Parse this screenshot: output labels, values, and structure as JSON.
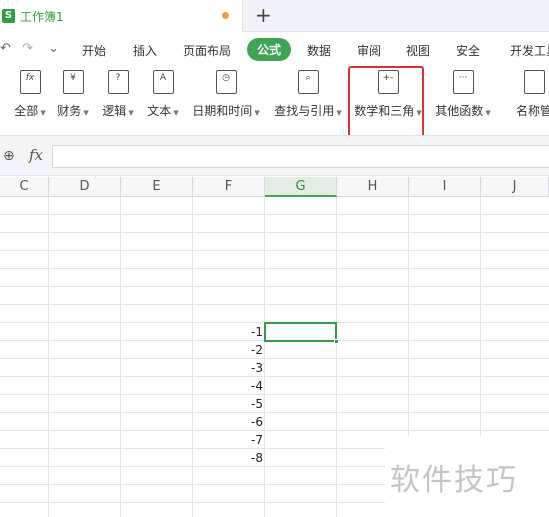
{
  "window": {
    "doc_tab_title": "工作簿1",
    "doc_icon_letter": "S",
    "new_tab_glyph": "+"
  },
  "quick_access": {
    "undo": "↶",
    "redo": "↷",
    "more": "⌄"
  },
  "menu": {
    "items": [
      "开始",
      "插入",
      "页面布局",
      "公式",
      "数据",
      "审阅",
      "视图",
      "安全",
      "开发工具"
    ],
    "active": "公式"
  },
  "ribbon": {
    "buttons": [
      {
        "label": "全部",
        "glyph": "fx"
      },
      {
        "label": "财务",
        "glyph": "¥"
      },
      {
        "label": "逻辑",
        "glyph": "?"
      },
      {
        "label": "文本",
        "glyph": "A"
      },
      {
        "label": "日期和时间",
        "glyph": "◷"
      },
      {
        "label": "查找与引用",
        "glyph": "⌕"
      },
      {
        "label": "数学和三角",
        "glyph": "+-"
      },
      {
        "label": "其他函数",
        "glyph": "···"
      },
      {
        "label": "名称管",
        "glyph": ""
      }
    ],
    "highlighted": "数学和三角"
  },
  "formula_bar": {
    "fx_label": "fx",
    "value": ""
  },
  "grid": {
    "columns": [
      "C",
      "D",
      "E",
      "F",
      "G",
      "H",
      "I",
      "J"
    ],
    "selected_column": "G",
    "column_f_values": [
      "-1",
      "-2",
      "-3",
      "-4",
      "-5",
      "-6",
      "-7",
      "-8"
    ]
  },
  "watermark": "软件技巧",
  "colors": {
    "accent": "#3fa457",
    "highlight_box": "#e03030"
  }
}
